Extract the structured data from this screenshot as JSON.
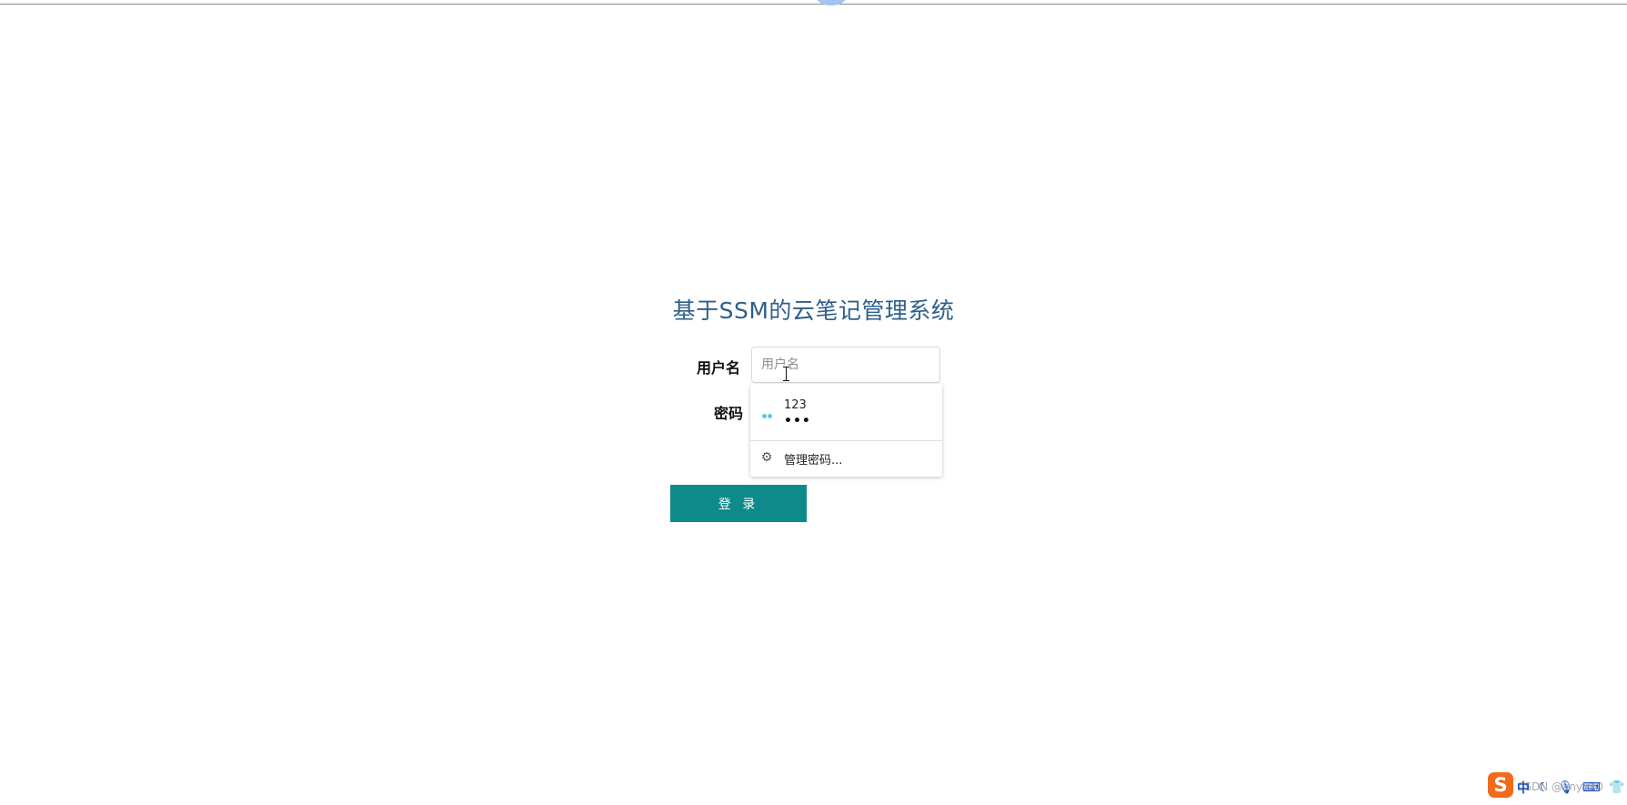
{
  "page": {
    "title": "基于SSM的云笔记管理系统"
  },
  "form": {
    "username_label": "用户名",
    "username_placeholder": "用户名",
    "username_value": "",
    "password_label": "密码",
    "login_button_label": "登 录"
  },
  "autofill": {
    "saved_username": "123",
    "saved_password_mask": "•••",
    "manage_label": "管理密码...",
    "key_icon": "key-icon",
    "key_color": "#5fc9e0",
    "manage_icon": "gear-icon"
  },
  "theme": {
    "title_color": "#2f5f8a",
    "button_color": "#0f8a8a"
  },
  "taskbar": {
    "ime_logo": "S",
    "ime_mode": "中",
    "ime_icons": [
      "moon-icon",
      "mic-icon",
      "keyboard-icon",
      "shirt-icon",
      "grid-icon"
    ],
    "watermark": "CSDN @anyu10"
  }
}
